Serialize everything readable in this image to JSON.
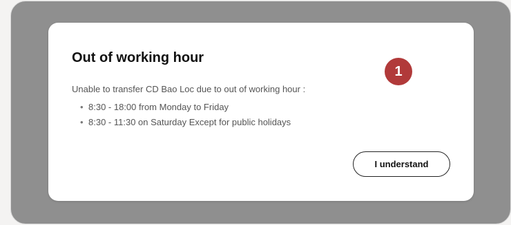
{
  "dialog": {
    "title": "Out of working hour",
    "message": "Unable to transfer CD Bao Loc due to out of working hour :",
    "hours": [
      "8:30 - 18:00 from Monday to Friday",
      "8:30 - 11:30 on Saturday Except for public holidays"
    ],
    "bullet": "•",
    "badge": "1",
    "confirm_label": "I understand"
  },
  "colors": {
    "overlay": "#8f8f8f",
    "badge": "#b13a3a",
    "dialog_bg": "#ffffff"
  }
}
